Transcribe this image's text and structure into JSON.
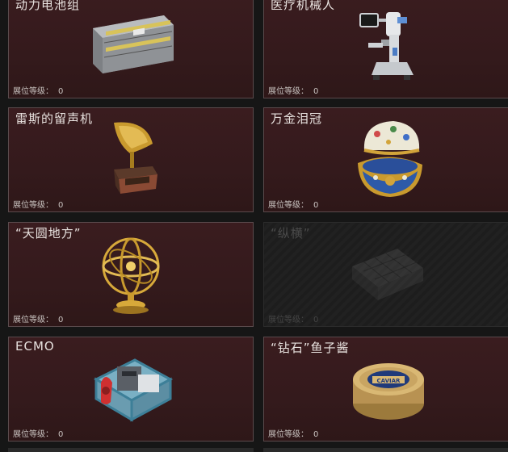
{
  "level_label": "展位等级：",
  "cards": [
    {
      "name": "动力电池组",
      "level": "0",
      "icon": "battery-pack-icon",
      "locked": false
    },
    {
      "name": "医疗机械人",
      "level": "0",
      "icon": "medical-robot-icon",
      "locked": false
    },
    {
      "name": "雷斯的留声机",
      "level": "0",
      "icon": "gramophone-icon",
      "locked": false
    },
    {
      "name": "万金泪冠",
      "level": "0",
      "icon": "jeweled-egg-icon",
      "locked": false
    },
    {
      "name": "“天圆地方”",
      "level": "0",
      "icon": "armillary-sphere-icon",
      "locked": false
    },
    {
      "name": "“纵横”",
      "level": "0",
      "icon": "chess-board-icon",
      "locked": true
    },
    {
      "name": "ECMO",
      "level": "0",
      "icon": "ecmo-machine-icon",
      "locked": false
    },
    {
      "name": "“钻石”鱼子酱",
      "level": "0",
      "icon": "caviar-tin-icon",
      "locked": false
    }
  ],
  "colors": {
    "card_bg": "#3a1c1f",
    "card_border": "#5a4a4c",
    "locked_bg": "#1d1d1d"
  }
}
